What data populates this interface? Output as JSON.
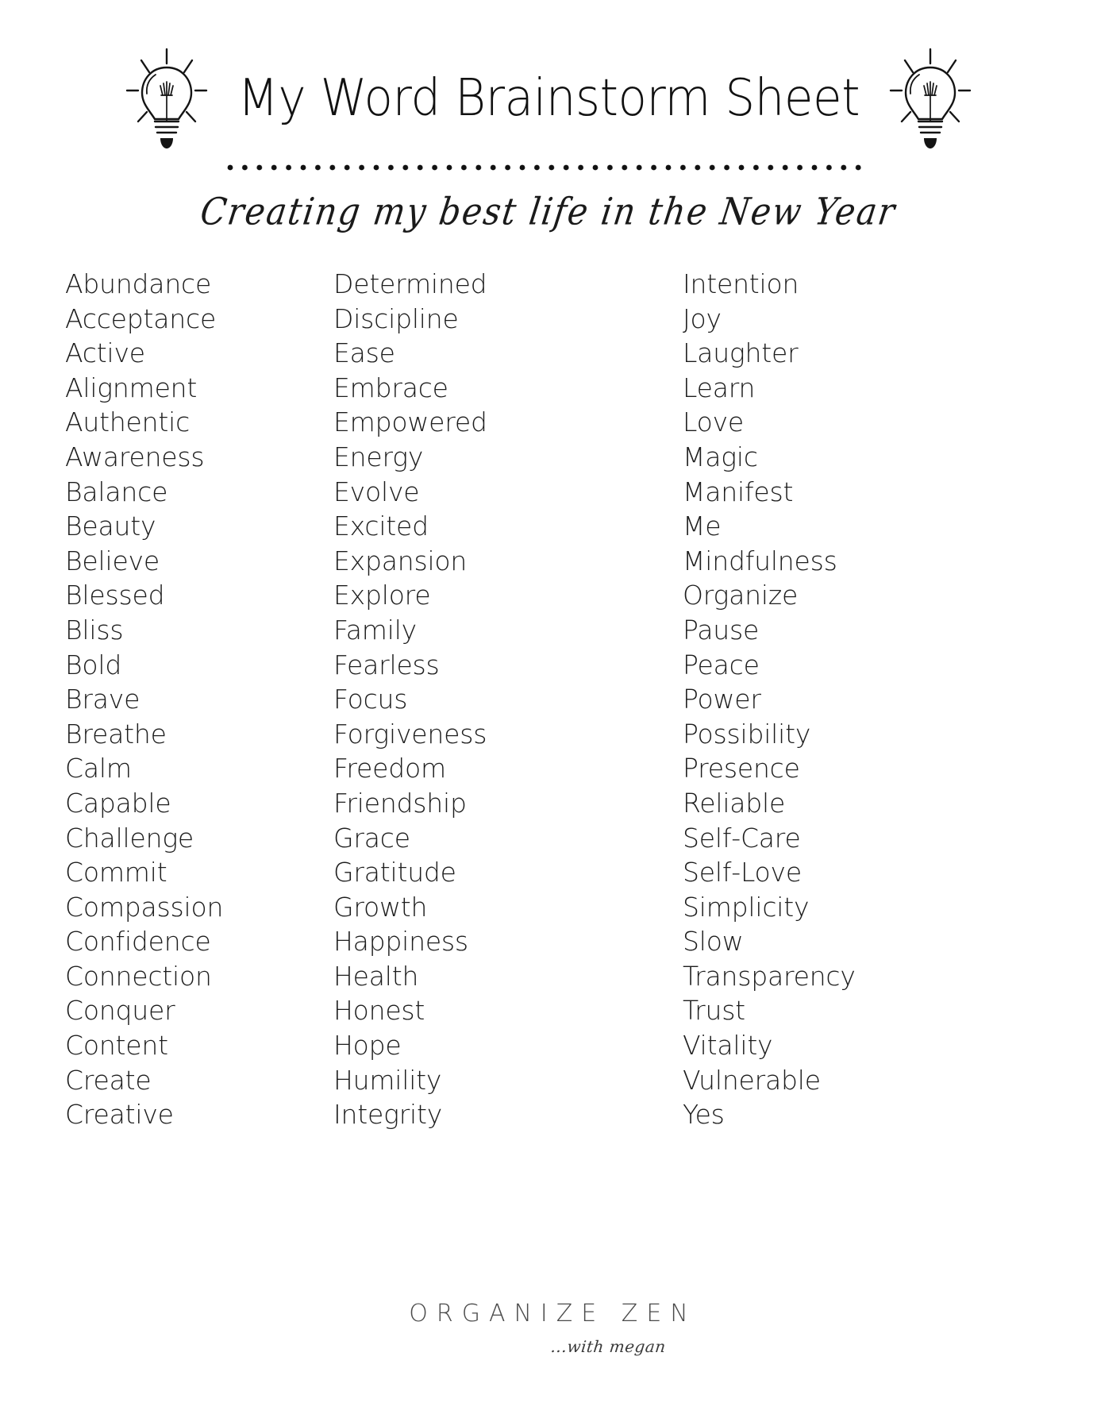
{
  "header": {
    "title": "My Word Brainstorm Sheet",
    "left_bulb_icon": "lightbulb-icon",
    "right_bulb_icon": "lightbulb-icon",
    "divider": "dotted-divider"
  },
  "subtitle": "Creating my best life in the New Year",
  "columns": [
    {
      "id": "column-1",
      "words": [
        "Abundance",
        "Acceptance",
        "Active",
        "Alignment",
        "Authentic",
        "Awareness",
        "Balance",
        "Beauty",
        "Believe",
        "Blessed",
        "Bliss",
        "Bold",
        "Brave",
        "Breathe",
        "Calm",
        "Capable",
        "Challenge",
        "Commit",
        "Compassion",
        "Confidence",
        "Connection",
        "Conquer",
        "Content",
        "Create",
        "Creative"
      ]
    },
    {
      "id": "column-2",
      "words": [
        "Determined",
        "Discipline",
        "Ease",
        "Embrace",
        "Empowered",
        "Energy",
        "Evolve",
        "Excited",
        "Expansion",
        "Explore",
        "Family",
        "Fearless",
        "Focus",
        "Forgiveness",
        "Freedom",
        "Friendship",
        "Grace",
        "Gratitude",
        "Growth",
        "Happiness",
        "Health",
        "Honest",
        "Hope",
        "Humility",
        "Integrity"
      ]
    },
    {
      "id": "column-3",
      "words": [
        "Intention",
        "Joy",
        "Laughter",
        "Learn",
        "Love",
        "Magic",
        "Manifest",
        "Me",
        "Mindfulness",
        "Organize",
        "Pause",
        "Peace",
        "Power",
        "Possibility",
        "Presence",
        "Reliable",
        "Self-Care",
        "Self-Love",
        "Simplicity",
        "Slow",
        "Transparency",
        "Trust",
        "Vitality",
        "Vulnerable",
        "Yes"
      ]
    }
  ],
  "footer": {
    "brand": "ORGANIZE ZEN",
    "brand_sub": "...with megan"
  },
  "colors": {
    "ink": "#1a1a1a",
    "paper": "#ffffff",
    "muted": "#4a4a4a"
  }
}
